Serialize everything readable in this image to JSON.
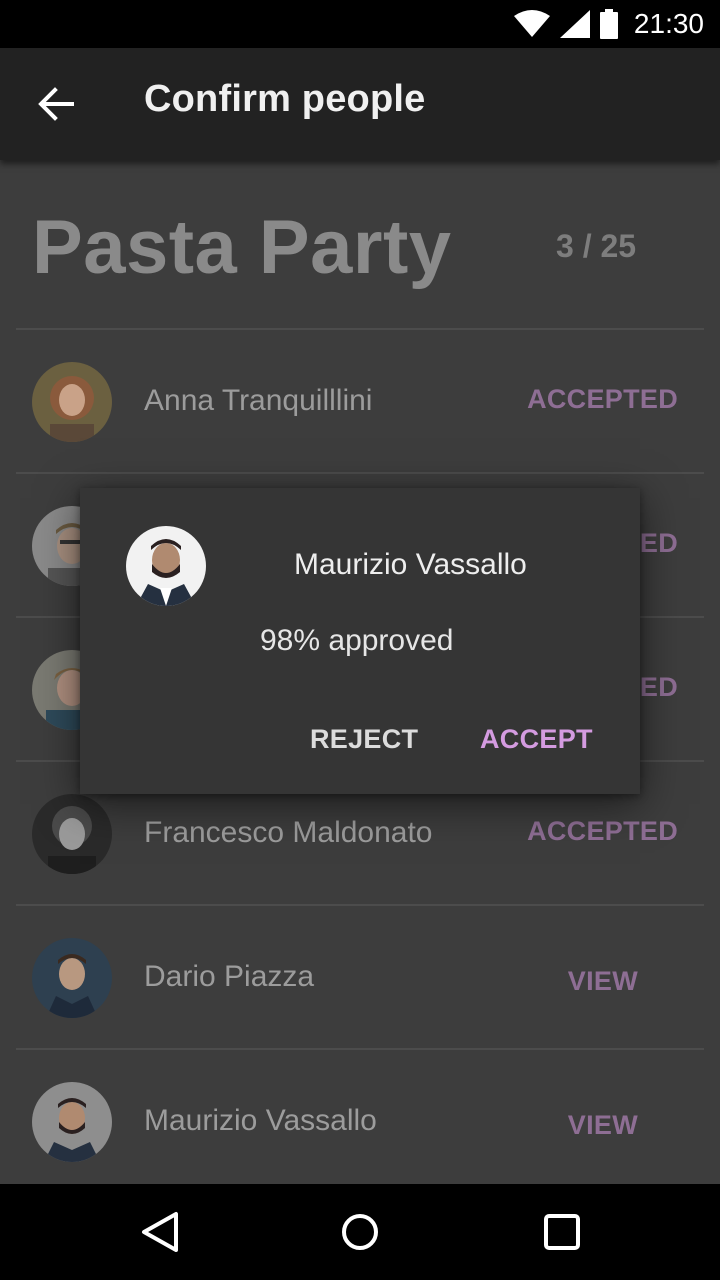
{
  "status_bar": {
    "time": "21:30"
  },
  "app_bar": {
    "title": "Confirm people"
  },
  "event": {
    "title": "Pasta Party",
    "count": "3 / 25"
  },
  "people": [
    {
      "name": "Anna Tranquilllini",
      "status": "ACCEPTED"
    },
    {
      "name": "",
      "status": "ACCEPTED"
    },
    {
      "name": "",
      "status": "ACCEPTED"
    },
    {
      "name": "Francesco Maldonato",
      "status": "ACCEPTED"
    },
    {
      "name": "Dario Piazza",
      "status": "VIEW"
    },
    {
      "name": "Maurizio Vassallo",
      "status": "VIEW"
    }
  ],
  "dialog": {
    "name": "Maurizio Vassallo",
    "approval": "98% approved",
    "reject_label": "REJECT",
    "accept_label": "ACCEPT"
  },
  "colors": {
    "accent": "#d49be0",
    "accent_dimmed": "#8e6e94",
    "background": "#3d3d3d",
    "app_bar": "#222222"
  },
  "icons": {
    "back": "arrow-left-icon",
    "wifi": "wifi-icon",
    "signal": "cell-signal-icon",
    "battery": "battery-icon",
    "nav_back": "triangle-back-icon",
    "nav_home": "circle-home-icon",
    "nav_recents": "square-recents-icon"
  }
}
